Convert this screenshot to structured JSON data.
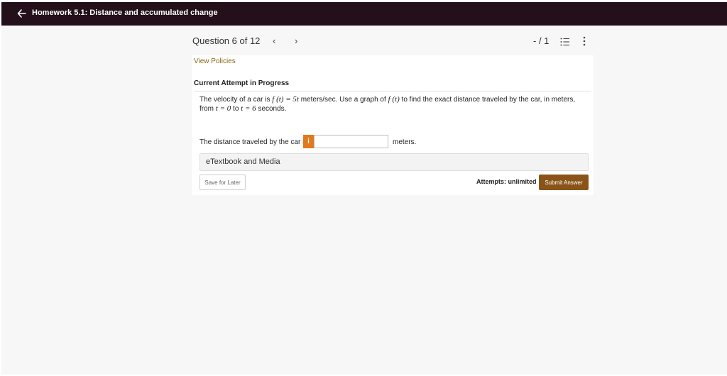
{
  "header": {
    "title": "Homework 5.1: Distance and accumulated change",
    "back_icon": "arrow-left-icon"
  },
  "question_nav": {
    "label": "Question 6 of 12",
    "prev_icon": "chevron-left-icon",
    "next_icon": "chevron-right-icon",
    "prev_glyph": "‹",
    "next_glyph": "›",
    "score": "- / 1",
    "list_icon": "question-list-icon",
    "more_icon": "more-vertical-icon"
  },
  "panel": {
    "view_policies": "View Policies",
    "attempt_heading": "Current Attempt in Progress",
    "question_parts": {
      "p1": "The velocity of a car is",
      "m1": "f (t) = 5t",
      "p2": "meters/sec. Use a graph of",
      "m2": "f (t)",
      "p3": "to find the exact distance traveled by the car, in meters, from",
      "m3": "t = 0",
      "p4": "to",
      "m4": "t = 6",
      "p5": "seconds."
    },
    "answer_prefix": "The distance traveled by the car is",
    "info_badge": "i",
    "answer_value": "",
    "answer_suffix": "meters.",
    "etextbook": "eTextbook and Media",
    "save_later": "Save for Later",
    "attempts": "Attempts: unlimited",
    "submit": "Submit Answer"
  },
  "colors": {
    "topbar": "#23101a",
    "link": "#8a6416",
    "info_badge": "#e07a1f",
    "submit": "#8a5418"
  }
}
